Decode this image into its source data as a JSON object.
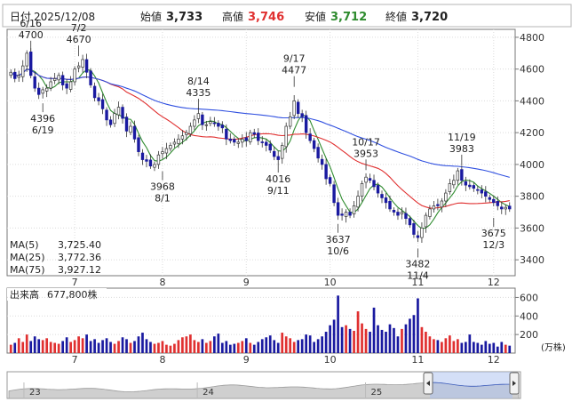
{
  "header": {
    "date_label": "日付",
    "date": "2025/12/08",
    "open_label": "始値",
    "open": "3,733",
    "high_label": "高値",
    "high": "3,746",
    "low_label": "安値",
    "low": "3,712",
    "close_label": "終値",
    "close": "3,720"
  },
  "ma_legend": [
    {
      "label": "MA(5)",
      "value": "3,725.40",
      "color": "#2e8b2e"
    },
    {
      "label": "MA(25)",
      "value": "3,772.36",
      "color": "#e03030"
    },
    {
      "label": "MA(75)",
      "value": "3,927.12",
      "color": "#3050e0"
    }
  ],
  "volume_label": "出来高",
  "volume_value": "677,800株",
  "volume_unit": "(万株)",
  "colors": {
    "up": "#e03030",
    "down": "#1a1aa0",
    "ma5": "#2e8b2e",
    "ma25": "#e03030",
    "ma75": "#3050e0",
    "nav_fill": "#a9bff0"
  },
  "chart_data": {
    "type": "candlestick",
    "price_axis": {
      "ticks": [
        4800,
        4600,
        4400,
        4200,
        4000,
        3800,
        3600,
        3400
      ],
      "range": [
        3300,
        4850
      ]
    },
    "volume_axis": {
      "ticks": [
        600,
        400,
        200
      ],
      "range": [
        0,
        700
      ]
    },
    "month_labels": [
      {
        "label": "7",
        "bar": 16
      },
      {
        "label": "8",
        "bar": 38
      },
      {
        "label": "9",
        "bar": 59
      },
      {
        "label": "10",
        "bar": 80
      },
      {
        "label": "11",
        "bar": 102
      },
      {
        "label": "12",
        "bar": 121
      }
    ],
    "nav_labels": [
      {
        "label": "23",
        "fx": 0.04
      },
      {
        "label": "24",
        "fx": 0.38
      },
      {
        "label": "25",
        "fx": 0.71
      }
    ],
    "annotations": [
      {
        "top": "6/16",
        "bottom": "4700",
        "bar": 5,
        "value": 4700,
        "pos": "above"
      },
      {
        "top": "7/2",
        "bottom": "4670",
        "bar": 17,
        "value": 4670,
        "pos": "above"
      },
      {
        "top": "4396",
        "bottom": "6/19",
        "bar": 8,
        "value": 4396,
        "pos": "below"
      },
      {
        "top": "8/14",
        "bottom": "4335",
        "bar": 47,
        "value": 4335,
        "pos": "above"
      },
      {
        "top": "3968",
        "bottom": "8/1",
        "bar": 38,
        "value": 3968,
        "pos": "below"
      },
      {
        "top": "9/17",
        "bottom": "4477",
        "bar": 71,
        "value": 4477,
        "pos": "above"
      },
      {
        "top": "4016",
        "bottom": "9/11",
        "bar": 67,
        "value": 4016,
        "pos": "below"
      },
      {
        "top": "10/17",
        "bottom": "3953",
        "bar": 89,
        "value": 3953,
        "pos": "above"
      },
      {
        "top": "3637",
        "bottom": "10/6",
        "bar": 82,
        "value": 3637,
        "pos": "below"
      },
      {
        "top": "11/19",
        "bottom": "3983",
        "bar": 113,
        "value": 3983,
        "pos": "above"
      },
      {
        "top": "3482",
        "bottom": "11/4",
        "bar": 102,
        "value": 3482,
        "pos": "below"
      },
      {
        "top": "3675",
        "bottom": "12/3",
        "bar": 121,
        "value": 3675,
        "pos": "below"
      }
    ],
    "closes": [
      4580,
      4540,
      4560,
      4620,
      4700,
      4560,
      4480,
      4440,
      4470,
      4480,
      4520,
      4540,
      4560,
      4500,
      4480,
      4520,
      4600,
      4620,
      4660,
      4580,
      4500,
      4420,
      4400,
      4350,
      4280,
      4250,
      4320,
      4360,
      4290,
      4210,
      4240,
      4160,
      4080,
      4030,
      4020,
      3990,
      4000,
      4060,
      4080,
      4100,
      4120,
      4140,
      4160,
      4180,
      4200,
      4240,
      4280,
      4320,
      4250,
      4250,
      4270,
      4260,
      4240,
      4230,
      4160,
      4150,
      4140,
      4140,
      4160,
      4150,
      4200,
      4190,
      4150,
      4140,
      4120,
      4090,
      4050,
      4030,
      4120,
      4240,
      4300,
      4400,
      4320,
      4300,
      4200,
      4150,
      4100,
      4040,
      4000,
      3910,
      3880,
      3760,
      3680,
      3680,
      3700,
      3680,
      3740,
      3800,
      3880,
      3920,
      3900,
      3860,
      3820,
      3790,
      3760,
      3720,
      3700,
      3680,
      3700,
      3660,
      3620,
      3560,
      3540,
      3600,
      3680,
      3720,
      3740,
      3740,
      3770,
      3820,
      3880,
      3900,
      3960,
      3900,
      3870,
      3860,
      3850,
      3840,
      3820,
      3800,
      3780,
      3760,
      3740,
      3720,
      3730,
      3720
    ],
    "volumes": [
      90,
      110,
      160,
      120,
      200,
      130,
      180,
      150,
      140,
      160,
      120,
      110,
      100,
      130,
      170,
      120,
      140,
      180,
      160,
      200,
      130,
      150,
      110,
      140,
      160,
      120,
      100,
      130,
      170,
      150,
      110,
      130,
      180,
      220,
      150,
      120,
      100,
      110,
      130,
      90,
      80,
      100,
      140,
      170,
      180,
      200,
      140,
      120,
      150,
      110,
      130,
      180,
      210,
      110,
      130,
      90,
      100,
      110,
      130,
      160,
      110,
      90,
      120,
      150,
      170,
      190,
      140,
      110,
      220,
      180,
      160,
      120,
      140,
      150,
      200,
      190,
      120,
      150,
      180,
      230,
      300,
      360,
      620,
      280,
      300,
      260,
      240,
      450,
      320,
      260,
      230,
      490,
      300,
      250,
      230,
      310,
      270,
      180,
      260,
      310,
      370,
      410,
      590,
      280,
      230,
      180,
      150,
      140,
      120,
      160,
      190,
      130,
      150,
      110,
      120,
      200,
      120,
      110,
      90,
      130,
      100,
      110,
      70,
      120,
      90,
      80
    ]
  }
}
